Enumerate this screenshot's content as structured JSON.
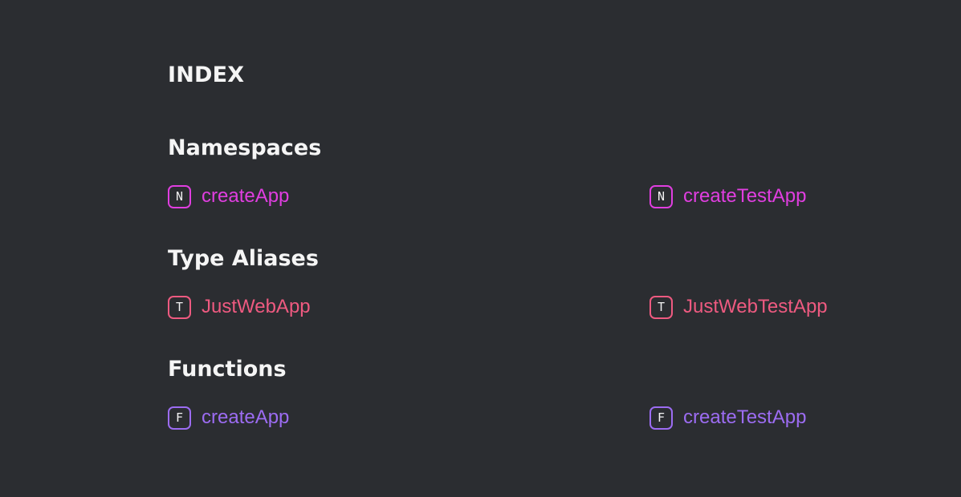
{
  "index": {
    "title": "INDEX"
  },
  "groups": [
    {
      "title": "Namespaces",
      "color": "#e03ee0",
      "items": [
        {
          "kind": "N",
          "label": "createApp",
          "icon": "namespace-icon"
        },
        {
          "kind": "N",
          "label": "createTestApp",
          "icon": "namespace-icon"
        }
      ]
    },
    {
      "title": "Type Aliases",
      "color": "#ee5a80",
      "items": [
        {
          "kind": "T",
          "label": "JustWebApp",
          "icon": "type-alias-icon"
        },
        {
          "kind": "T",
          "label": "JustWebTestApp",
          "icon": "type-alias-icon"
        }
      ]
    },
    {
      "title": "Functions",
      "color": "#9c6cf2",
      "items": [
        {
          "kind": "F",
          "label": "createApp",
          "icon": "function-icon"
        },
        {
          "kind": "F",
          "label": "createTestApp",
          "icon": "function-icon"
        }
      ]
    }
  ],
  "theme": {
    "background": "#2b2d31",
    "text": "#f5f5f5"
  }
}
